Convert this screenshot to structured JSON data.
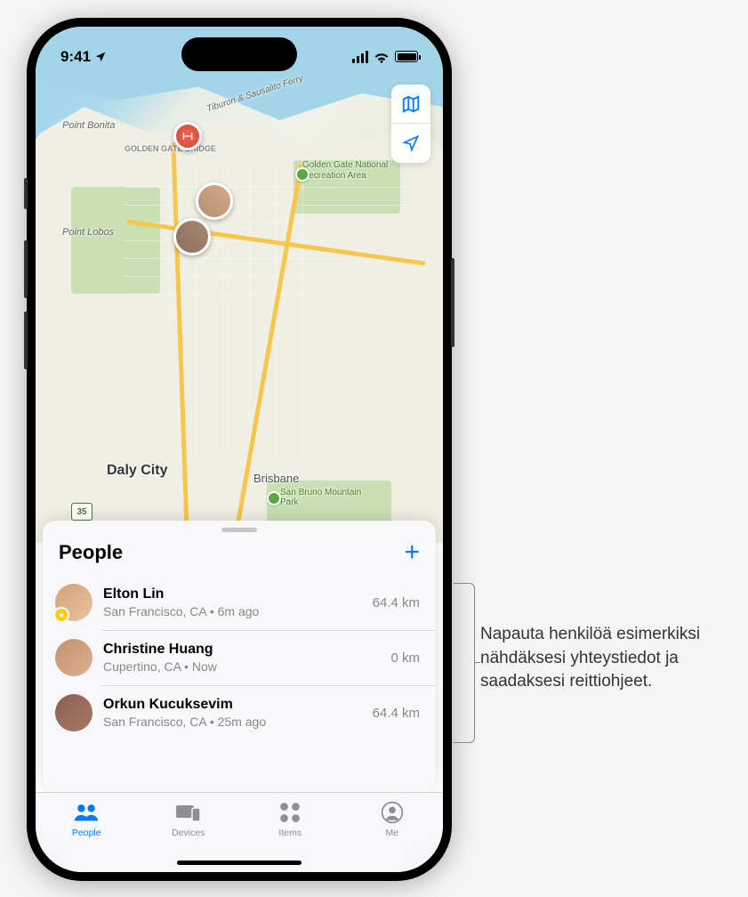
{
  "status_bar": {
    "time": "9:41"
  },
  "map": {
    "labels": {
      "point_bonita": "Point Bonita",
      "point_lobos": "Point Lobos",
      "daly_city": "Daly City",
      "brisbane": "Brisbane",
      "ferry": "Tiburon & Sausalito Ferry",
      "golden_gate_bridge": "GOLDEN GATE BRIDGE",
      "ggnra": "Golden Gate National Recreation Area",
      "san_bruno": "San Bruno Mountain Park",
      "route_35": "35"
    }
  },
  "sheet": {
    "title": "People",
    "people": [
      {
        "name": "Elton Lin",
        "location": "San Francisco, CA",
        "time": "6m ago",
        "distance": "64.4 km",
        "starred": true
      },
      {
        "name": "Christine Huang",
        "location": "Cupertino, CA",
        "time": "Now",
        "distance": "0 km",
        "starred": false
      },
      {
        "name": "Orkun Kucuksevim",
        "location": "San Francisco, CA",
        "time": "25m ago",
        "distance": "64.4 km",
        "starred": false
      }
    ]
  },
  "tabs": {
    "people": "People",
    "devices": "Devices",
    "items": "Items",
    "me": "Me"
  },
  "callout": {
    "text": "Napauta henkilöä esimerkiksi nähdäksesi yhteystiedot ja saadaksesi reittiohjeet."
  }
}
